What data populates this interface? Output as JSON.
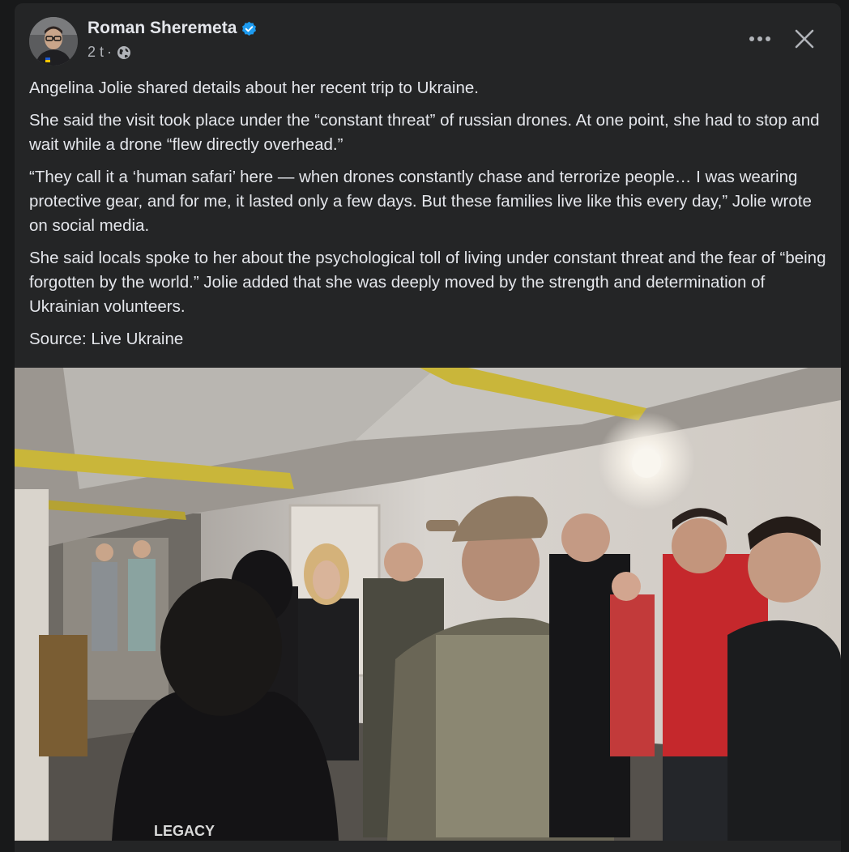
{
  "post": {
    "author": "Roman Sheremeta",
    "time": "2 t",
    "separator": "·",
    "paragraphs": [
      "Angelina Jolie shared details about her recent trip to Ukraine.",
      "She said the visit took place under the “constant threat” of russian drones. At one point, she had to stop and wait while a drone “flew directly overhead.”",
      "“They call it a ‘human safari’ here — when drones constantly chase and terrorize people… I was wearing protective gear, and for me, it lasted only a few days. But these families live like this every day,” Jolie wrote on social media.",
      "She said locals spoke to her about the psychological toll of living under constant threat and the fear of “being forgotten by the world.” Jolie added that she was deeply moved by the strength and determination of Ukrainian volunteers.",
      "Source: Live Ukraine"
    ],
    "photo_text": "LEGACY"
  },
  "icons": {
    "verified": "verified-badge-icon",
    "audience": "globe-icon",
    "more": "more-options-icon",
    "close": "close-icon"
  },
  "colors": {
    "background": "#18191a",
    "card": "#242526",
    "text_primary": "#e4e6eb",
    "text_secondary": "#b0b3b8",
    "verified_blue": "#1d9bf0"
  }
}
